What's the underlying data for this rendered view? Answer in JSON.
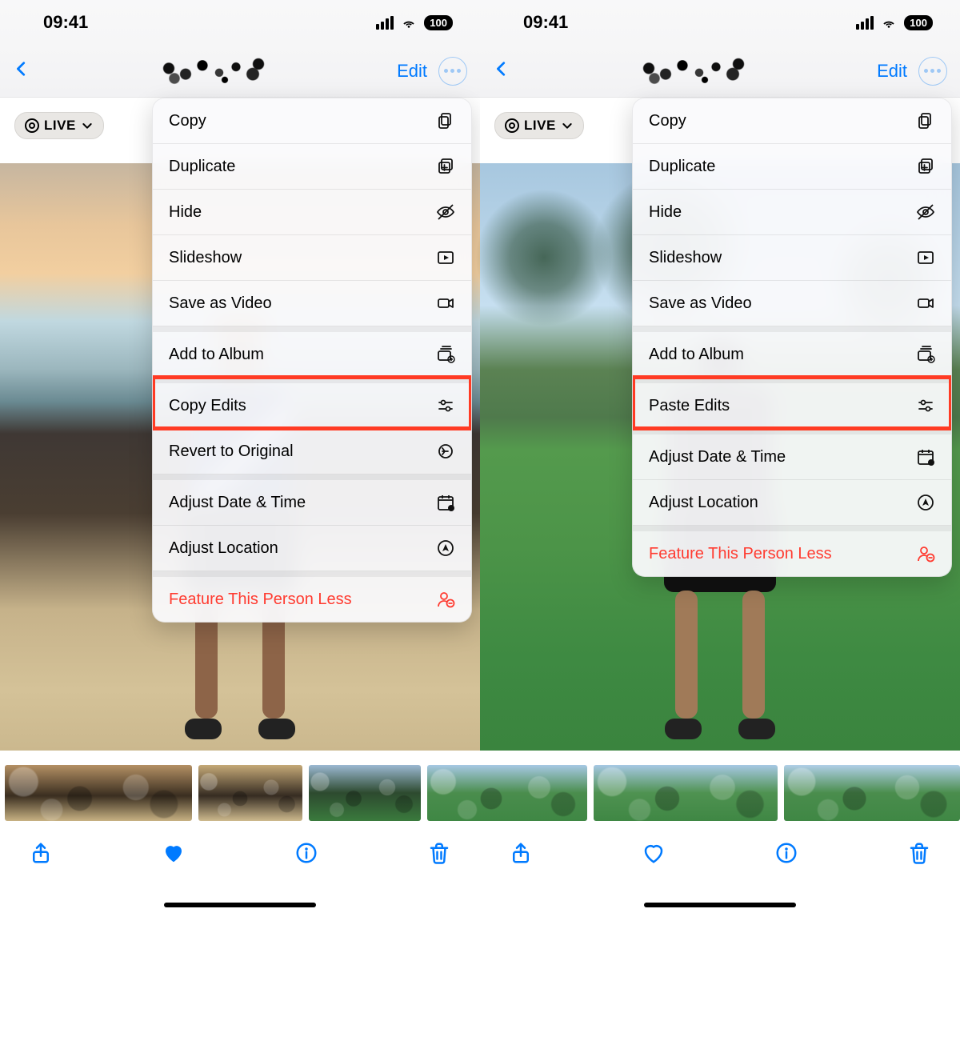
{
  "status": {
    "time": "09:41",
    "battery": "100"
  },
  "nav": {
    "edit": "Edit"
  },
  "live_badge": "LIVE",
  "menu_left": {
    "items": [
      {
        "label": "Copy",
        "icon": "doc-on-doc"
      },
      {
        "label": "Duplicate",
        "icon": "plus-square-on-square"
      },
      {
        "label": "Hide",
        "icon": "eye-slash"
      },
      {
        "label": "Slideshow",
        "icon": "play-rectangle"
      },
      {
        "label": "Save as Video",
        "icon": "video"
      },
      {
        "label": "Add to Album",
        "icon": "rectangle-stack-plus",
        "sep_before": true
      },
      {
        "label": "Copy Edits",
        "icon": "slider-copy",
        "sep_before": true,
        "highlighted": true
      },
      {
        "label": "Revert to Original",
        "icon": "revert"
      },
      {
        "label": "Adjust Date & Time",
        "icon": "calendar-badge",
        "sep_before": true
      },
      {
        "label": "Adjust Location",
        "icon": "location-circle"
      },
      {
        "label": "Feature This Person Less",
        "icon": "person-minus",
        "sep_before": true,
        "danger": true
      }
    ]
  },
  "menu_right": {
    "items": [
      {
        "label": "Copy",
        "icon": "doc-on-doc"
      },
      {
        "label": "Duplicate",
        "icon": "plus-square-on-square"
      },
      {
        "label": "Hide",
        "icon": "eye-slash"
      },
      {
        "label": "Slideshow",
        "icon": "play-rectangle"
      },
      {
        "label": "Save as Video",
        "icon": "video"
      },
      {
        "label": "Add to Album",
        "icon": "rectangle-stack-plus",
        "sep_before": true
      },
      {
        "label": "Paste Edits",
        "icon": "slider-paste",
        "sep_before": true,
        "highlighted": true
      },
      {
        "label": "Adjust Date & Time",
        "icon": "calendar-badge",
        "sep_before": true
      },
      {
        "label": "Adjust Location",
        "icon": "location-circle"
      },
      {
        "label": "Feature This Person Less",
        "icon": "person-minus",
        "sep_before": true,
        "danger": true
      }
    ]
  },
  "toolbar_left": {
    "favorite_filled": true
  },
  "toolbar_right": {
    "favorite_filled": false
  }
}
